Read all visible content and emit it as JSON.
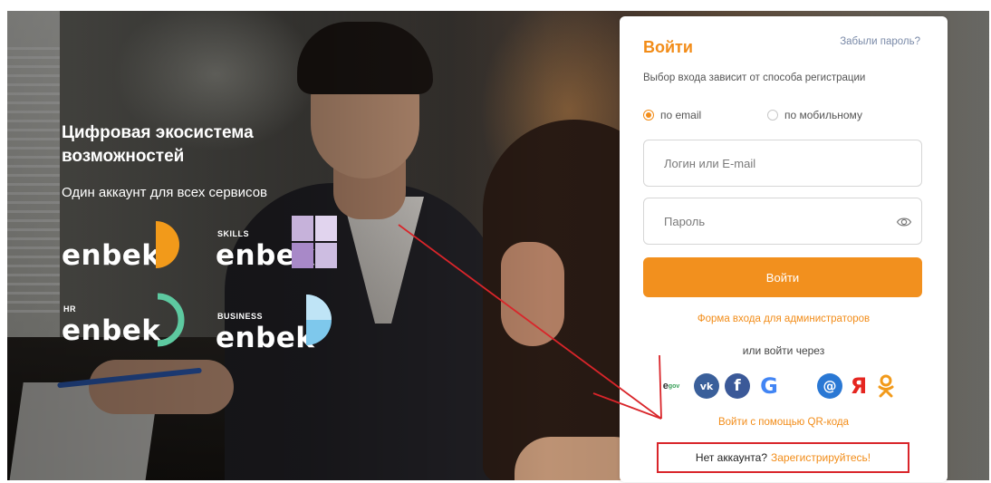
{
  "hero": {
    "title": "Цифровая экосистема возможностей",
    "subtitle": "Один аккаунт для всех сервисов",
    "logos": [
      {
        "tag": "",
        "word": "enbek"
      },
      {
        "tag": "SKILLS",
        "word": "enbek"
      },
      {
        "tag": "HR",
        "word": "enbek"
      },
      {
        "tag": "BUSINESS",
        "word": "enbek"
      }
    ]
  },
  "login": {
    "title": "Войти",
    "forgot": "Забыли пароль?",
    "hint": "Выбор входа зависит от способа регистрации",
    "radio_email": "по email",
    "radio_mobile": "по мобильному",
    "login_placeholder": "Логин или E-mail",
    "password_placeholder": "Пароль",
    "submit": "Войти",
    "admin_link": "Форма входа для администраторов",
    "or_via": "или войти через",
    "socials": {
      "egov": "e",
      "egov_sub": "gov",
      "vk": "vk",
      "fb": "f",
      "google": "G",
      "apple": "",
      "mail": "@",
      "yandex": "Я",
      "ok": "ok"
    },
    "qr_link": "Войти с помощью QR-кода",
    "no_account": "Нет аккаунта?",
    "register": "Зарегистрируйтесь!"
  },
  "colors": {
    "accent": "#f28c18",
    "annotation": "#d9252a"
  }
}
